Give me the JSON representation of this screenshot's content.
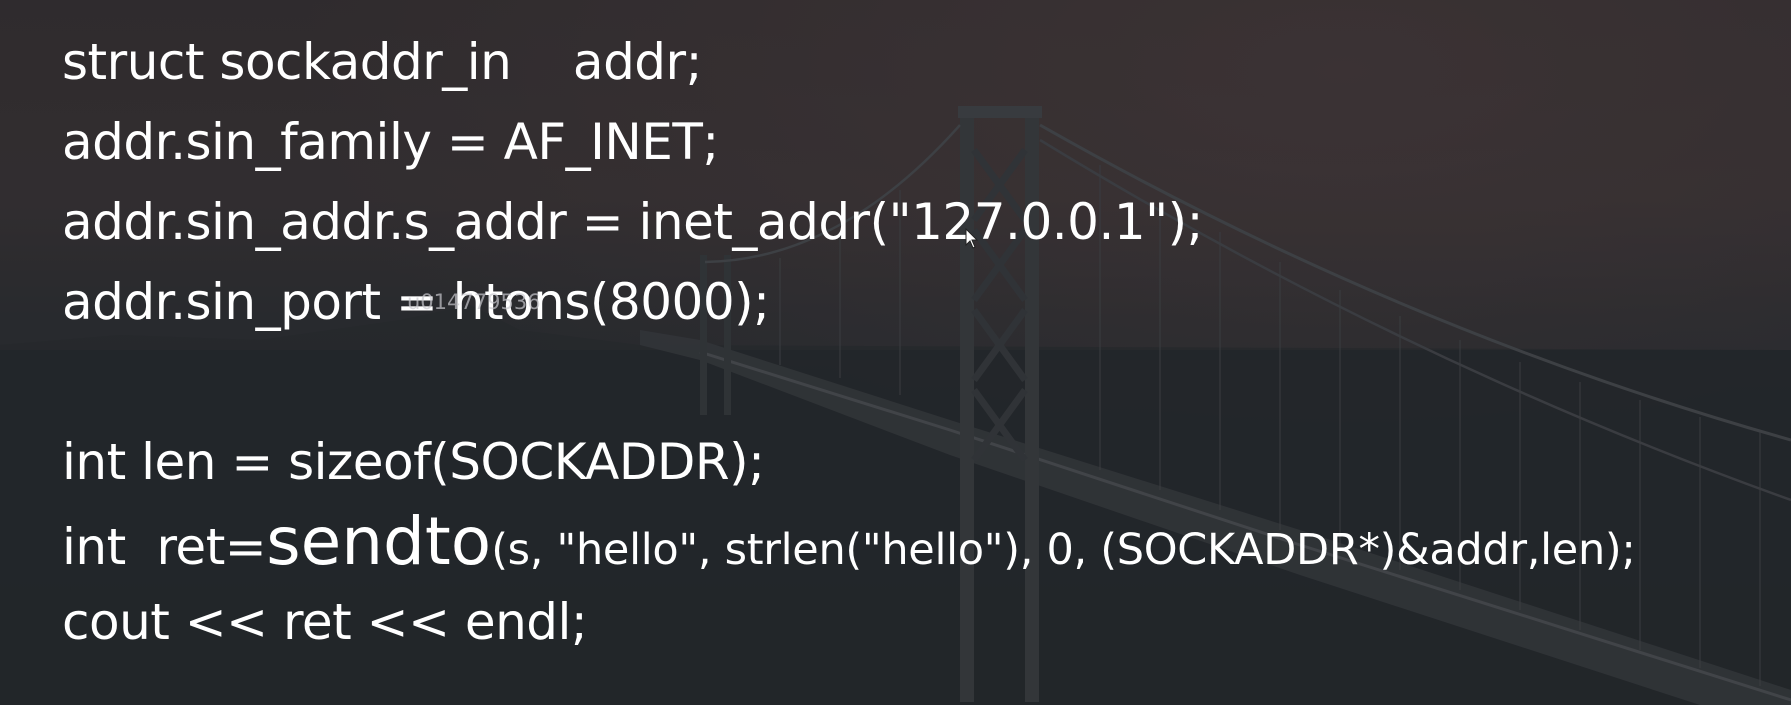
{
  "code": {
    "line1": "struct sockaddr_in    addr;",
    "line2": "addr.sin_family = AF_INET;",
    "line3": "addr.sin_addr.s_addr = inet_addr(\"127.0.0.1\");",
    "line4": "addr.sin_port = htons(8000);",
    "line5": "int len = sizeof(SOCKADDR);",
    "line6_prefix": "int  ret=",
    "line6_func": "sendto",
    "line6_args": "(s, \"hello\", strlen(\"hello\"), 0, (SOCKADDR*)&addr,len);",
    "line7": "cout << ret << endl;"
  },
  "watermark": "u014779536",
  "colors": {
    "text": "#ffffff",
    "watermark": "#c8c8cd"
  },
  "icons": {
    "cursor": "mouse-pointer-icon"
  }
}
